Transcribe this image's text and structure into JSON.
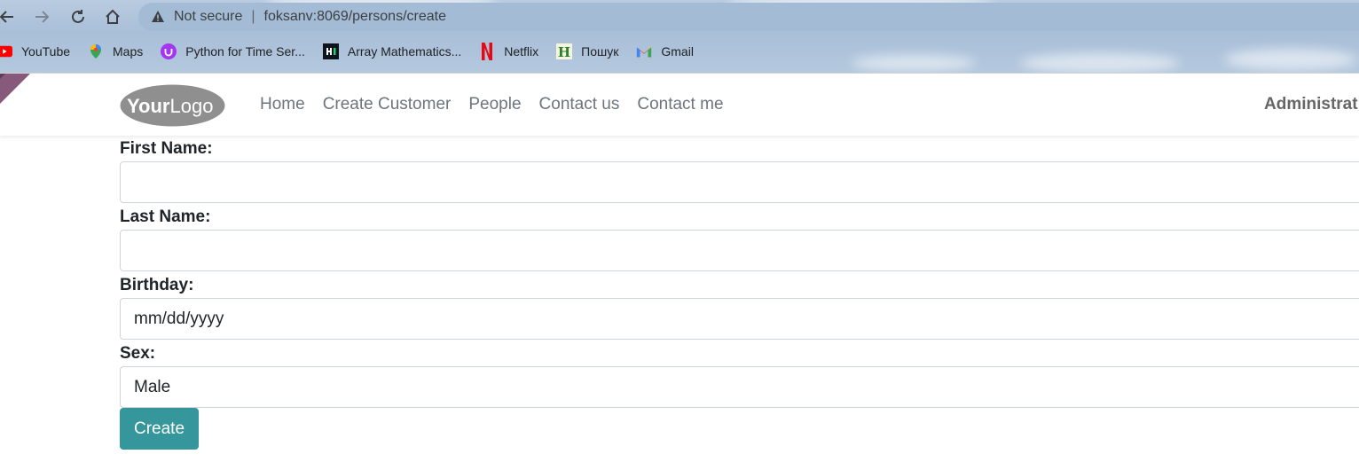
{
  "browser": {
    "status": "Not secure",
    "url": "foksanv:8069/persons/create",
    "bookmarks": [
      {
        "label": "YouTube",
        "icon": "youtube-icon"
      },
      {
        "label": "Maps",
        "icon": "maps-icon"
      },
      {
        "label": "Python for Time Ser...",
        "icon": "udemy-icon"
      },
      {
        "label": "Array Mathematics...",
        "icon": "hackerrank-icon"
      },
      {
        "label": "Netflix",
        "icon": "netflix-icon"
      },
      {
        "label": "Пошук",
        "icon": "search-h-icon"
      },
      {
        "label": "Gmail",
        "icon": "gmail-icon"
      }
    ]
  },
  "site": {
    "logo_text_bold": "Your",
    "logo_text_light": "Logo",
    "menu": [
      "Home",
      "Create Customer",
      "People",
      "Contact us",
      "Contact me"
    ],
    "user": "Administrat"
  },
  "form": {
    "first_name_label": "First Name:",
    "first_name_value": "",
    "last_name_label": "Last Name:",
    "last_name_value": "",
    "birthday_label": "Birthday:",
    "birthday_placeholder": "mm/dd/yyyy",
    "sex_label": "Sex:",
    "sex_value": "Male",
    "submit_label": "Create"
  },
  "colors": {
    "primary_button": "#35979c",
    "nav_text": "#6c757d"
  }
}
